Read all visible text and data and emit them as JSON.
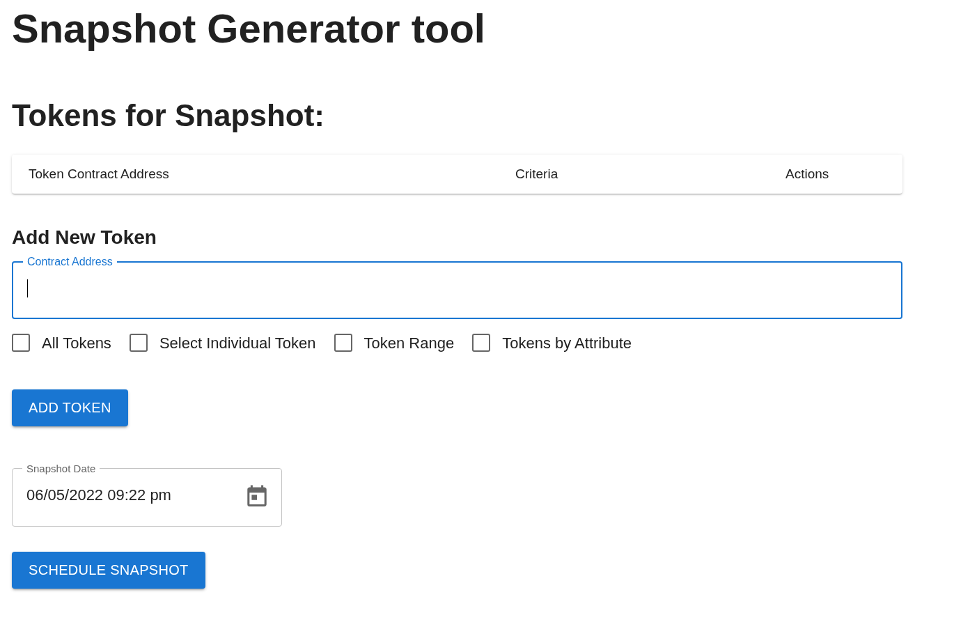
{
  "page_title": "Snapshot Generator tool",
  "tokens_section": {
    "heading": "Tokens for Snapshot:",
    "table": {
      "columns": [
        "Token Contract Address",
        "Criteria",
        "Actions"
      ]
    }
  },
  "add_token": {
    "heading": "Add New Token",
    "contract_field": {
      "label": "Contract Address",
      "focused": true
    },
    "criteria": [
      {
        "label": "All Tokens",
        "checked": false
      },
      {
        "label": "Select Individual Token",
        "checked": false
      },
      {
        "label": "Token Range",
        "checked": false
      },
      {
        "label": "Tokens by Attribute",
        "checked": false
      }
    ],
    "button": "ADD TOKEN"
  },
  "snapshot_date": {
    "label": "Snapshot Date",
    "value": "06/05/2022 09:22 pm"
  },
  "schedule_button": "SCHEDULE SNAPSHOT"
}
